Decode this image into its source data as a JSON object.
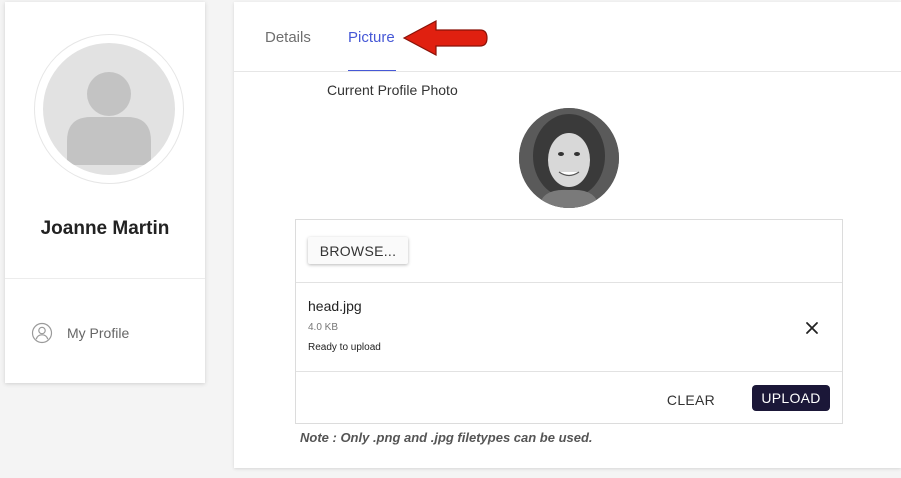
{
  "user": {
    "name": "Joanne Martin"
  },
  "sidebar": {
    "items": [
      {
        "label": "My Profile",
        "icon": "user-circle-icon"
      }
    ]
  },
  "tabs": [
    {
      "label": "Details",
      "active": false
    },
    {
      "label": "Picture",
      "active": true
    }
  ],
  "picture": {
    "title": "Current Profile Photo",
    "uploader": {
      "browse_label": "BROWSE...",
      "file": {
        "name": "head.jpg",
        "size": "4.0 KB",
        "status": "Ready to upload"
      },
      "remove_icon": "close-icon",
      "clear_label": "CLEAR",
      "upload_label": "UPLOAD"
    },
    "note": "Note : Only .png and .jpg filetypes can be used."
  },
  "colors": {
    "accent": "#4658d6",
    "upload_button": "#1b1738",
    "annotation_arrow": "#e02010"
  }
}
